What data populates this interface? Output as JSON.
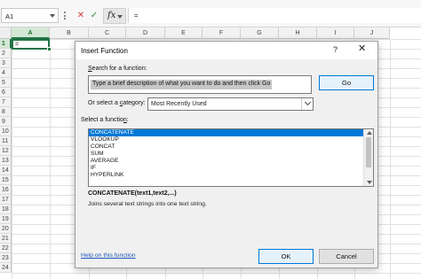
{
  "formula_bar": {
    "name_box": "A1",
    "cancel_icon": "close-icon",
    "enter_icon": "check-icon",
    "fx_label": "fx",
    "formula_value": "="
  },
  "columns": [
    "A",
    "B",
    "C",
    "D",
    "E",
    "F",
    "G",
    "H",
    "I",
    "J"
  ],
  "rows": [
    "1",
    "2",
    "3",
    "4",
    "5",
    "6",
    "7",
    "8",
    "9",
    "10",
    "11",
    "12",
    "13",
    "14",
    "15",
    "16",
    "17",
    "18",
    "19",
    "20",
    "21",
    "22",
    "23",
    "24"
  ],
  "active_cell_value": "=",
  "dialog": {
    "title": "Insert Function",
    "help_glyph": "?",
    "close_glyph": "✕",
    "search_label_prefix": "",
    "search_label_underlined": "S",
    "search_label_rest": "earch for a function:",
    "search_placeholder": "Type a brief description of what you want to do and then click Go",
    "go_label": "Go",
    "category_label_prefix": "Or select a ",
    "category_label_underlined": "c",
    "category_label_rest": "ategory:",
    "category_value": "Most Recently Used",
    "select_label_prefix": "Select a functio",
    "select_label_underlined": "n",
    "select_label_rest": ":",
    "functions": [
      "CONCATENATE",
      "VLOOKUP",
      "CONCAT",
      "SUM",
      "AVERAGE",
      "IF",
      "HYPERLINK"
    ],
    "selected_function": "CONCATENATE",
    "syntax": "CONCATENATE(text1,text2,...)",
    "description": "Joins several text strings into one text string.",
    "help_link": "Help on this function",
    "ok_label": "OK",
    "cancel_label": "Cancel"
  },
  "colors": {
    "excel_green": "#217346",
    "selection_blue": "#0078d7",
    "link_blue": "#1a56b8"
  }
}
